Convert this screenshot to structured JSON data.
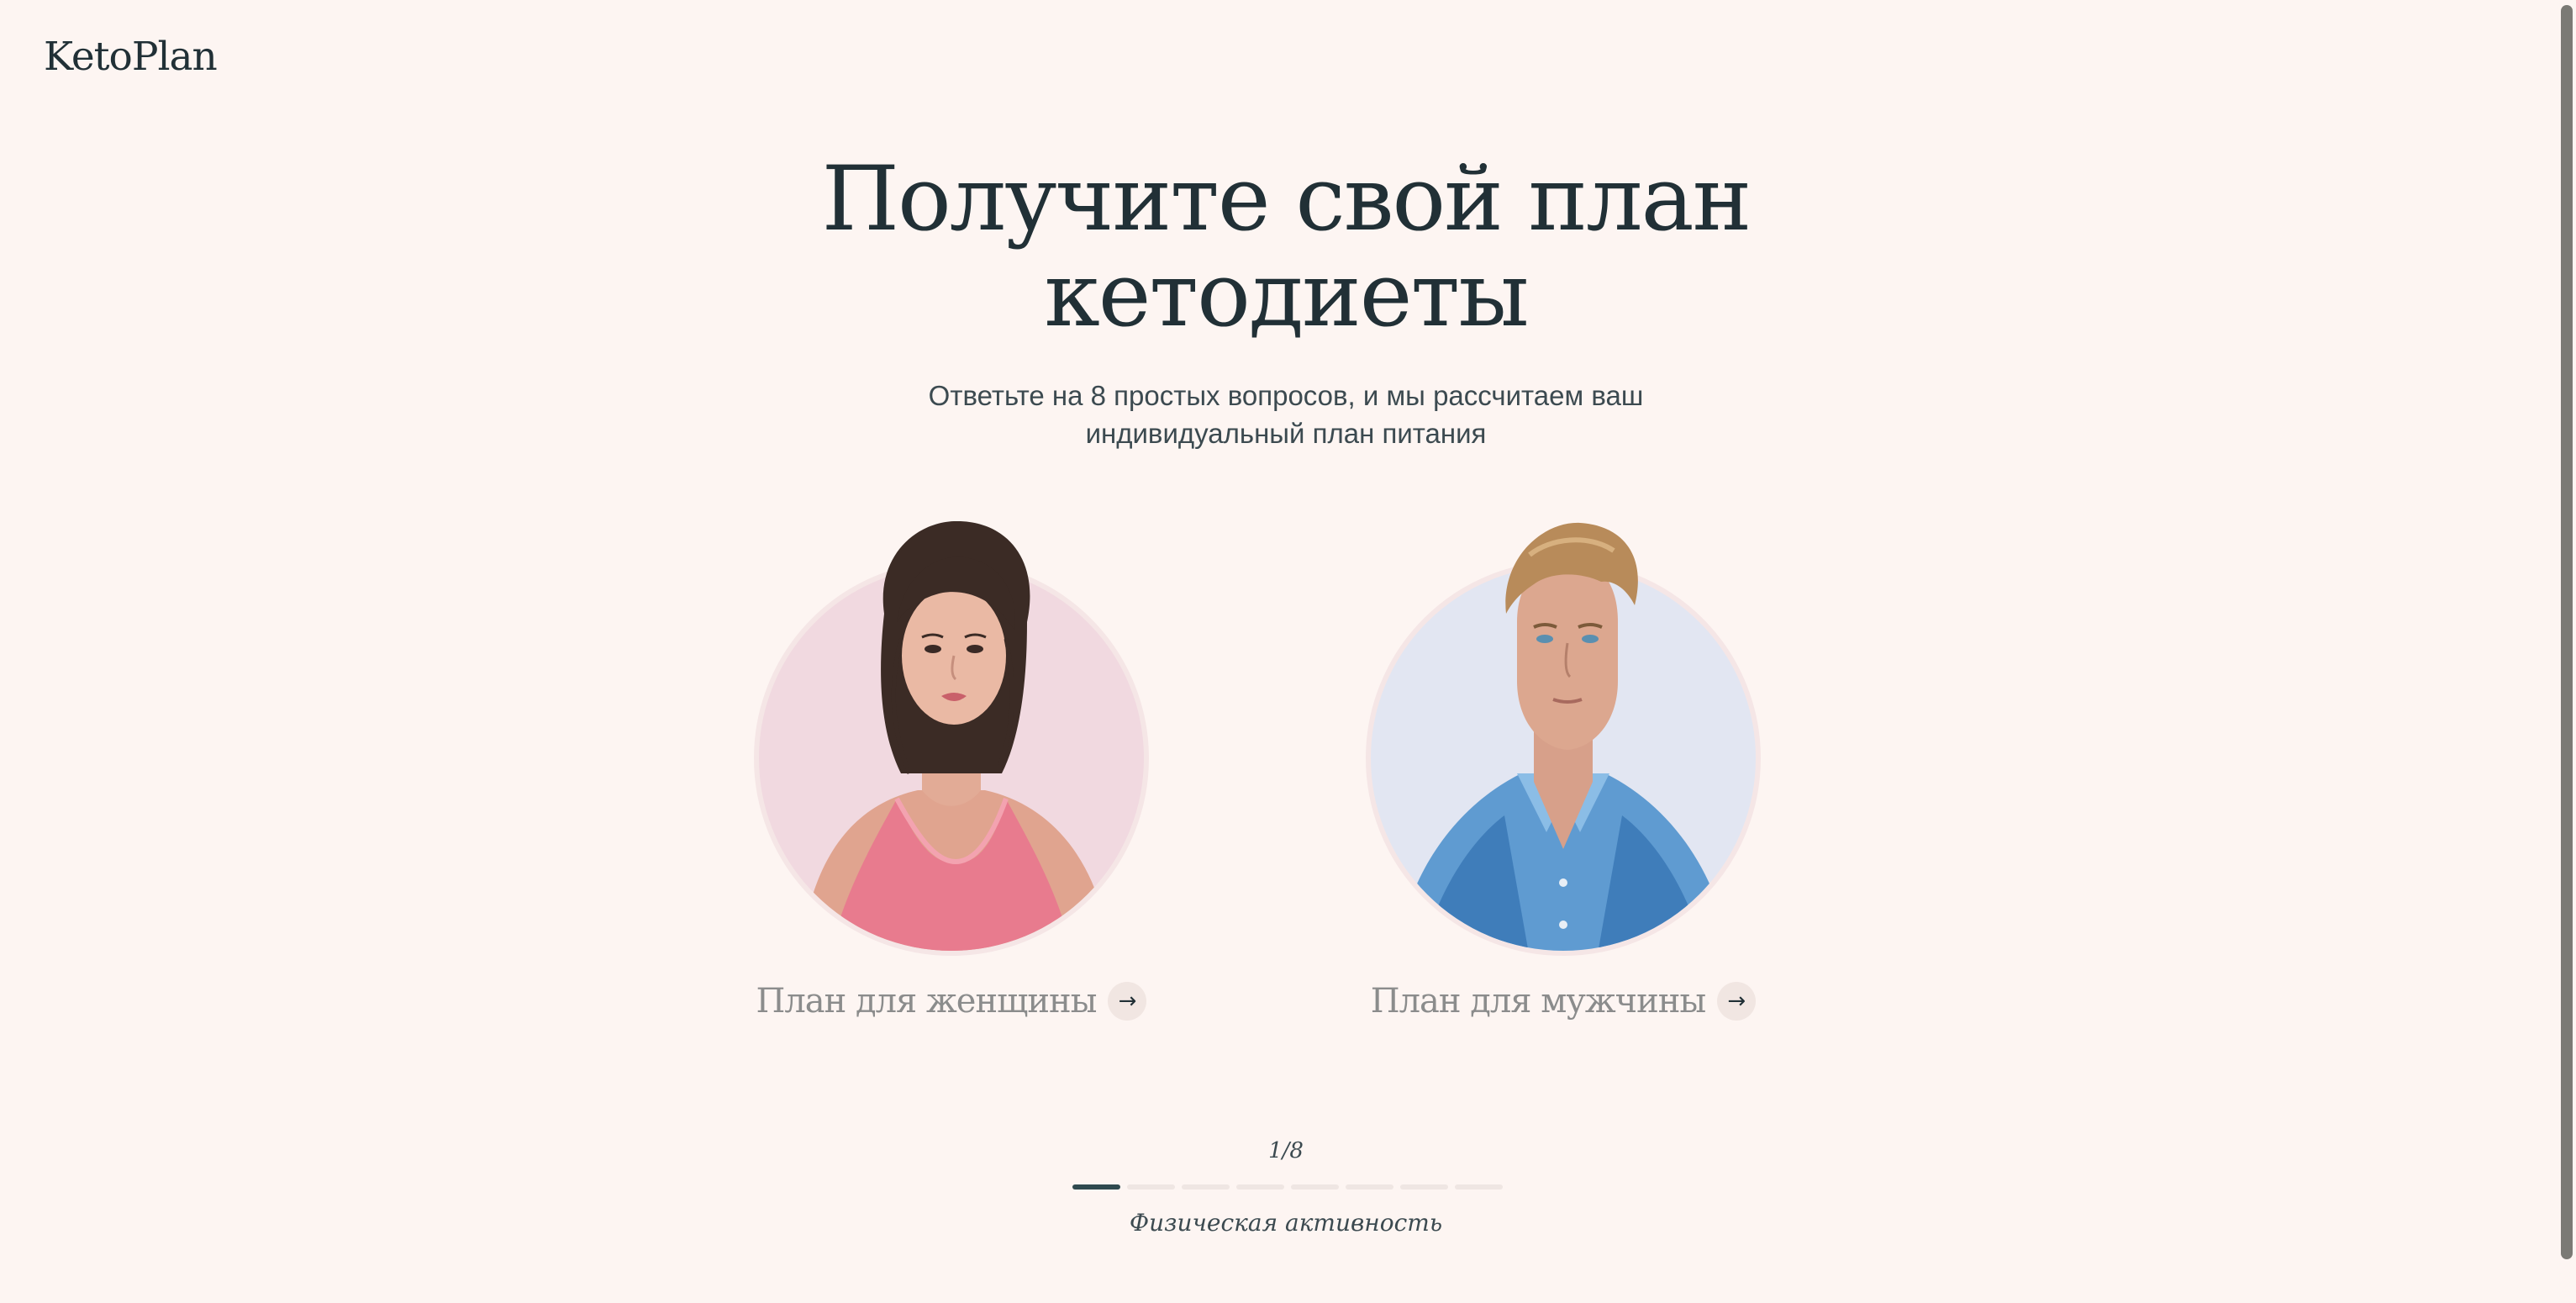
{
  "header": {
    "logo": "KetoPlan"
  },
  "hero": {
    "title_line1": "Получите свой план",
    "title_line2": "кетодиеты",
    "subtitle_line1": "Ответьте на 8 простых вопросов, и мы рассчитаем ваш",
    "subtitle_line2": "индивидуальный план питания"
  },
  "options": [
    {
      "label": "План для женщины",
      "icon": "arrow-right-icon",
      "circle_color": "#f1d9e0"
    },
    {
      "label": "План для мужчины",
      "icon": "arrow-right-icon",
      "circle_color": "#e2e6f2"
    }
  ],
  "progress": {
    "counter": "1/8",
    "current": 1,
    "total": 8,
    "step_label": "Физическая активность"
  },
  "colors": {
    "background": "#fdf5f2",
    "text": "#213036",
    "accent": "#2f4a4f"
  }
}
